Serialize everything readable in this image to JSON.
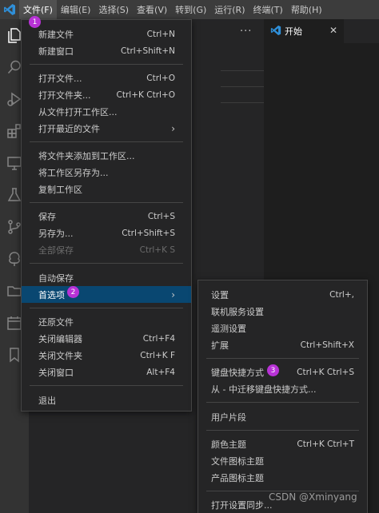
{
  "menubar": {
    "items": [
      "文件(F)",
      "编辑(E)",
      "选择(S)",
      "查看(V)",
      "转到(G)",
      "运行(R)",
      "终端(T)",
      "帮助(H)"
    ]
  },
  "editor": {
    "tab_label": "开始",
    "more_icon": "..."
  },
  "file_menu": {
    "items": [
      {
        "label": "新建文件",
        "shortcut": "Ctrl+N"
      },
      {
        "label": "新建窗口",
        "shortcut": "Ctrl+Shift+N"
      },
      {
        "label": "打开文件...",
        "shortcut": "Ctrl+O"
      },
      {
        "label": "打开文件夹...",
        "shortcut": "Ctrl+K Ctrl+O"
      },
      {
        "label": "从文件打开工作区...",
        "shortcut": ""
      },
      {
        "label": "打开最近的文件",
        "shortcut": ""
      },
      {
        "label": "将文件夹添加到工作区...",
        "shortcut": ""
      },
      {
        "label": "将工作区另存为...",
        "shortcut": ""
      },
      {
        "label": "复制工作区",
        "shortcut": ""
      },
      {
        "label": "保存",
        "shortcut": "Ctrl+S"
      },
      {
        "label": "另存为...",
        "shortcut": "Ctrl+Shift+S"
      },
      {
        "label": "全部保存",
        "shortcut": "Ctrl+K S"
      },
      {
        "label": "自动保存",
        "shortcut": ""
      },
      {
        "label": "首选项",
        "shortcut": ""
      },
      {
        "label": "还原文件",
        "shortcut": ""
      },
      {
        "label": "关闭编辑器",
        "shortcut": "Ctrl+F4"
      },
      {
        "label": "关闭文件夹",
        "shortcut": "Ctrl+K F"
      },
      {
        "label": "关闭窗口",
        "shortcut": "Alt+F4"
      },
      {
        "label": "退出",
        "shortcut": ""
      }
    ]
  },
  "preferences_menu": {
    "items": [
      {
        "label": "设置",
        "shortcut": "Ctrl+,"
      },
      {
        "label": "联机服务设置",
        "shortcut": ""
      },
      {
        "label": "遥测设置",
        "shortcut": ""
      },
      {
        "label": "扩展",
        "shortcut": "Ctrl+Shift+X"
      },
      {
        "label": "键盘快捷方式",
        "shortcut": "Ctrl+K Ctrl+S"
      },
      {
        "label": "从 - 中迁移键盘快捷方式...",
        "shortcut": ""
      },
      {
        "label": "用户片段",
        "shortcut": ""
      },
      {
        "label": "颜色主题",
        "shortcut": "Ctrl+K Ctrl+T"
      },
      {
        "label": "文件图标主题",
        "shortcut": ""
      },
      {
        "label": "产品图标主题",
        "shortcut": ""
      },
      {
        "label": "打开设置同步...",
        "shortcut": ""
      }
    ]
  },
  "annotations": [
    "1",
    "2",
    "3"
  ],
  "watermark": "CSDN @Xminyang",
  "colors": {
    "accent": "#094771",
    "badge": "#b832d6",
    "logo": "#2f8fd8"
  }
}
